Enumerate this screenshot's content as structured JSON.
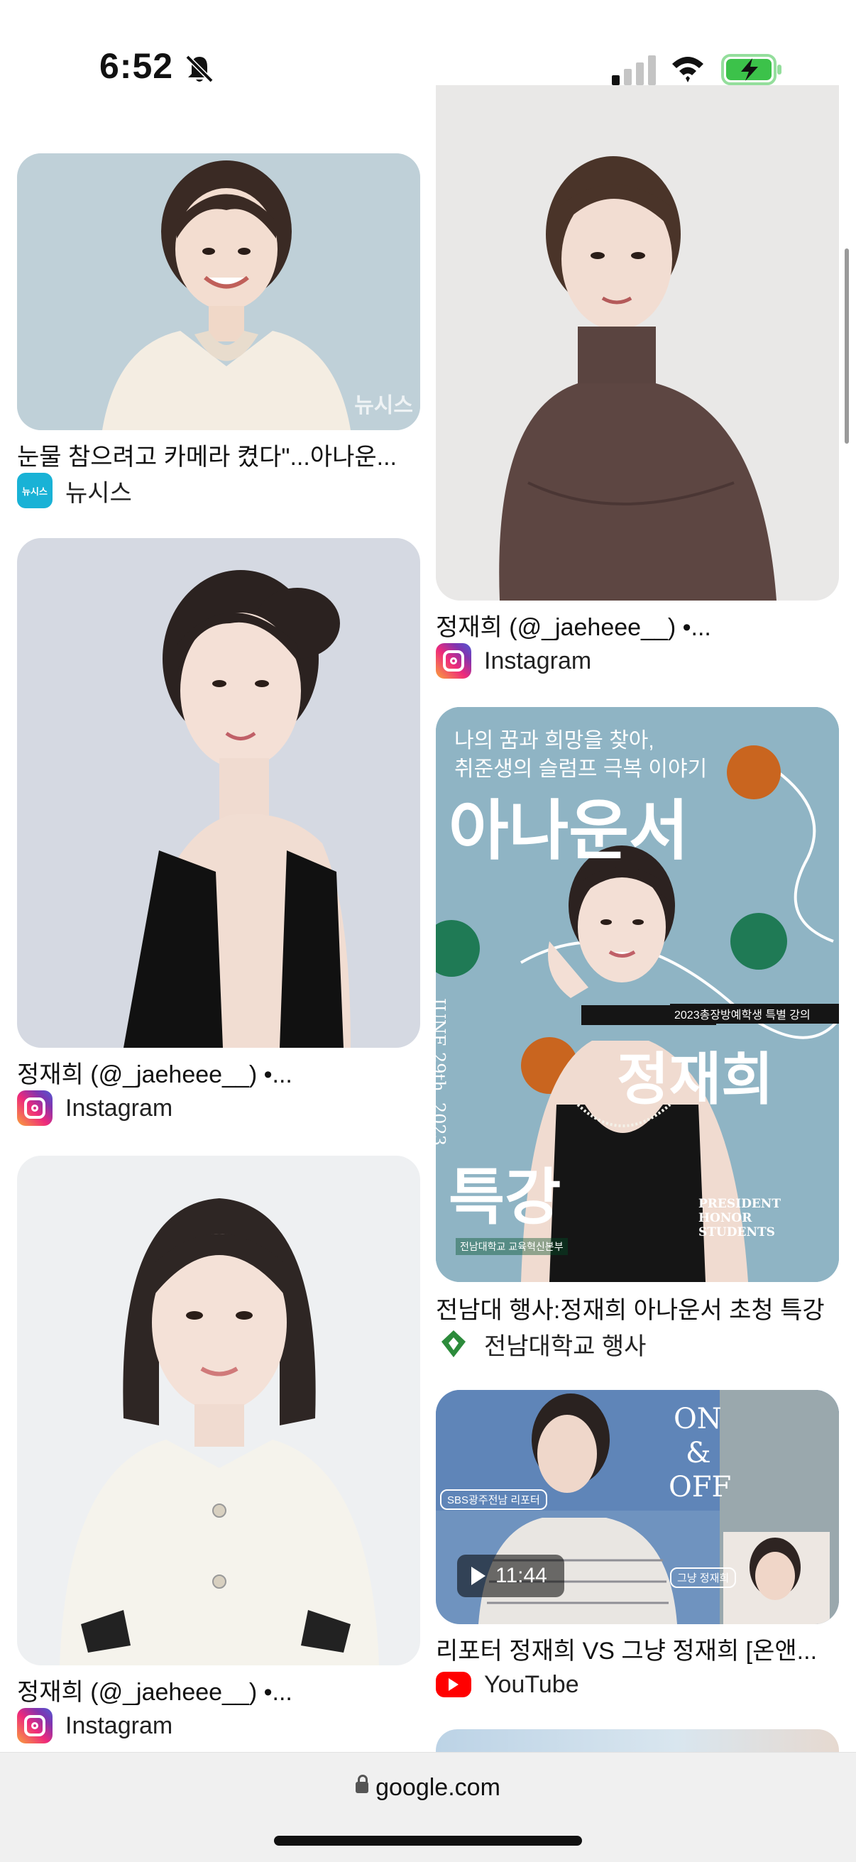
{
  "status": {
    "time": "6:52"
  },
  "feed": {
    "left": [
      {
        "caption": "눈물 참으려고 카메라 켰다\"...아나운...",
        "source": "뉴시스",
        "icon": "newsis-icon",
        "watermark": "뉴시스"
      },
      {
        "caption": "정재희 (@_jaeheee__) •...",
        "source": "Instagram",
        "icon": "instagram-icon"
      },
      {
        "caption": "정재희 (@_jaeheee__) •...",
        "source": "Instagram",
        "icon": "instagram-icon"
      }
    ],
    "right": [
      {
        "caption": "정재희 (@_jaeheee__) •...",
        "source": "Instagram",
        "icon": "instagram-icon"
      },
      {
        "caption": "전남대 행사:정재희 아나운서 초청 특강",
        "source": "전남대학교 행사",
        "icon": "jnu-icon",
        "poster": {
          "line1": "나의 꿈과 희망을 찾아,",
          "line2": "취준생의 슬럼프 극복 이야기",
          "title": "아나운서",
          "name": "정재희",
          "lecture": "특강",
          "date": "JUNE 29th, 2023",
          "tag": "2023총장방예학생 특별 강의",
          "english": "PRESIDENT HONOR STUDENTS",
          "org": "전남대학교 교육혁신본부"
        }
      },
      {
        "caption": "리포터 정재희 VS 그냥 정재희 [온앤...",
        "source": "YouTube",
        "icon": "youtube-icon",
        "duration": "11:44",
        "thumb": {
          "on": "ON",
          "amp": "&",
          "off": "OFF",
          "tag1": "SBS광주전남 리포터",
          "tag2": "그냥 정재희"
        }
      }
    ]
  },
  "bottom": {
    "url": "google.com"
  },
  "colors": {
    "poster_bg": "#8fb4c4",
    "poster_orange": "#c9651f",
    "poster_green": "#1f7a55"
  }
}
